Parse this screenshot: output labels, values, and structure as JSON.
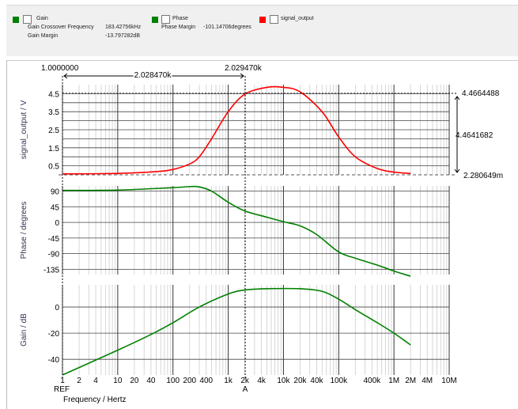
{
  "legend": {
    "gain": {
      "label": "Gain",
      "color": "#008000",
      "items": [
        {
          "name": "Gain Crossover Frequency",
          "value": "183.42756kHz"
        },
        {
          "name": "Gain Margin",
          "value": "-13.797282dB"
        }
      ]
    },
    "phase": {
      "label": "Phase",
      "color": "#008000",
      "items": [
        {
          "name": "Phase Margin",
          "value": "-101.14706degrees"
        }
      ]
    },
    "signal": {
      "label": "signal_output",
      "color": "#ff0000"
    }
  },
  "cursors": {
    "ref_value": "1.0000000",
    "a_value": "2.029470k",
    "delta": "2.028470k",
    "ref_label": "REF",
    "a_label": "A",
    "y_top": "4.4664488",
    "y_delta": "4.4641682",
    "y_bottom": "2.280649m"
  },
  "x_axis": {
    "label": "Frequency / Hertz",
    "ticks": [
      "1",
      "2",
      "4",
      "10",
      "20",
      "40",
      "100",
      "200",
      "400",
      "1k",
      "2k",
      "4k",
      "10k",
      "20k",
      "40k",
      "100k",
      "400k",
      "1M",
      "2M",
      "4M",
      "10M"
    ]
  },
  "chart_data": [
    {
      "type": "line",
      "ylabel": "signal_output / V",
      "xscale": "log",
      "ylim": [
        0,
        5
      ],
      "yticks": [
        "0.5",
        "1.5",
        "2.5",
        "3.5",
        "4.5"
      ],
      "color": "#ff0000",
      "x": [
        1,
        10,
        50,
        100,
        200,
        300,
        500,
        1000,
        2000,
        5000,
        10000,
        20000,
        50000,
        100000,
        200000,
        500000,
        1000000,
        2000000
      ],
      "y": [
        0.05,
        0.08,
        0.18,
        0.3,
        0.6,
        1.0,
        2.0,
        3.5,
        4.47,
        4.85,
        4.85,
        4.6,
        3.5,
        2.1,
        1.0,
        0.35,
        0.15,
        0.08
      ]
    },
    {
      "type": "line",
      "ylabel": "Phase / degrees",
      "xscale": "log",
      "ylim": [
        -150,
        105
      ],
      "yticks": [
        "90",
        "45",
        "0",
        "-45",
        "-90",
        "-135"
      ],
      "color": "#008000",
      "x": [
        1,
        10,
        100,
        200,
        300,
        500,
        1000,
        2000,
        5000,
        10000,
        20000,
        40000,
        100000,
        200000,
        500000,
        1000000,
        2000000
      ],
      "y": [
        92,
        93,
        100,
        103,
        102,
        90,
        58,
        33,
        15,
        2,
        -10,
        -35,
        -85,
        -103,
        -123,
        -140,
        -155
      ]
    },
    {
      "type": "line",
      "ylabel": "Gain / dB",
      "xscale": "log",
      "ylim": [
        -52,
        17
      ],
      "yticks": [
        "0",
        "-20",
        "-40"
      ],
      "color": "#008000",
      "x": [
        1,
        10,
        40,
        100,
        300,
        1000,
        2000,
        5000,
        20000,
        50000,
        100000,
        200000,
        500000,
        1000000,
        2000000
      ],
      "y": [
        -52,
        -33,
        -21,
        -12,
        0,
        10,
        13,
        14,
        14,
        12,
        6,
        -2,
        -12,
        -20,
        -29
      ]
    }
  ]
}
